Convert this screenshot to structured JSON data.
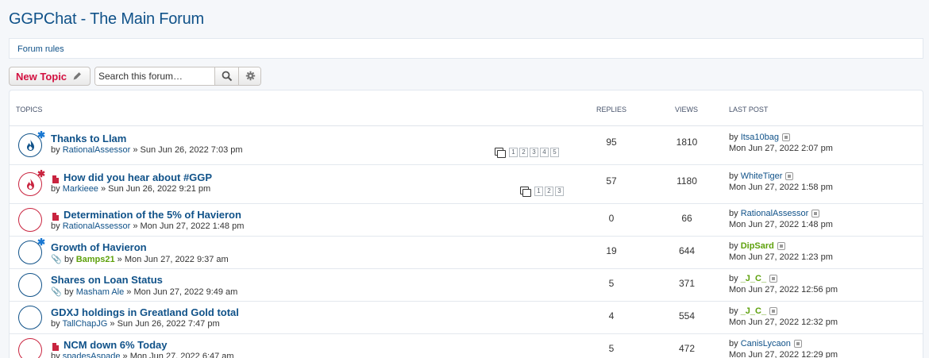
{
  "page": {
    "title": "GGPChat - The Main Forum",
    "forum_rules": "Forum rules"
  },
  "actions": {
    "new_topic": "New Topic",
    "search_placeholder": "Search this forum…"
  },
  "header": {
    "topics": "TOPICS",
    "replies": "REPLIES",
    "views": "VIEWS",
    "last_post": "LAST POST"
  },
  "topics": [
    {
      "title": "Thanks to Llam",
      "author": "RationalAssessor",
      "date": "» Sun Jun 26, 2022 7:03 pm",
      "replies": "95",
      "views": "1810",
      "last_by": "Itsa10bag",
      "last_date": "Mon Jun 27, 2022 2:07 pm",
      "pages": [
        "1",
        "2",
        "3",
        "4",
        "5"
      ],
      "icon": "flame-unread-icon"
    },
    {
      "title": "How did you hear about #GGP",
      "author": "Markieee",
      "date": "» Sun Jun 26, 2022 9:21 pm",
      "replies": "57",
      "views": "1180",
      "last_by": "WhiteTiger",
      "last_date": "Mon Jun 27, 2022 1:58 pm",
      "pages": [
        "1",
        "2",
        "3"
      ],
      "icon": "flame-unread-icon"
    },
    {
      "title": "Determination of the 5% of Havieron",
      "author": "RationalAssessor",
      "date": "» Mon Jun 27, 2022 1:48 pm",
      "replies": "0",
      "views": "66",
      "last_by": "RationalAssessor",
      "last_date": "Mon Jun 27, 2022 1:48 pm",
      "icon": "topic-read-icon"
    },
    {
      "title": "Growth of Havieron",
      "by": "by",
      "author": "Bamps21",
      "date": "» Mon Jun 27, 2022 9:37 am",
      "replies": "19",
      "views": "644",
      "last_by": "DipSard",
      "last_date": "Mon Jun 27, 2022 1:23 pm",
      "icon": "topic-unread-icon"
    },
    {
      "title": "Shares on Loan Status",
      "author": "Masham Ale",
      "date": "» Mon Jun 27, 2022 9:49 am",
      "replies": "5",
      "views": "371",
      "last_by": "_J_C_",
      "last_date": "Mon Jun 27, 2022 12:56 pm",
      "icon": "topic-read-icon"
    },
    {
      "title": "GDXJ holdings in Greatland Gold total",
      "author": "TallChapJG",
      "date": "» Sun Jun 26, 2022 7:47 pm",
      "replies": "4",
      "views": "554",
      "last_by": "_J_C_",
      "last_date": "Mon Jun 27, 2022 12:32 pm",
      "icon": "topic-read-icon"
    },
    {
      "title": "NCM down 6% Today",
      "author": "spadesAspade",
      "date": "» Mon Jun 27, 2022 6:47 am",
      "replies": "5",
      "views": "472",
      "last_by": "CanisLycaon",
      "last_date": "Mon Jun 27, 2022 12:29 pm",
      "icon": "topic-read-icon"
    }
  ],
  "by_label": "by",
  "colors": {
    "link": "#105289",
    "accent_red": "#d31141",
    "user_green": "#5ea10c"
  }
}
